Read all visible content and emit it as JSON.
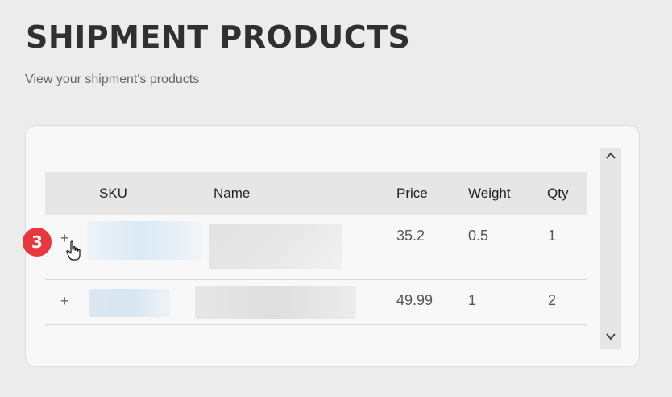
{
  "header": {
    "title": "SHIPMENT PRODUCTS",
    "subtitle": "View your shipment's products"
  },
  "table": {
    "columns": [
      "SKU",
      "Name",
      "Price",
      "Weight",
      "Qty"
    ],
    "rows": [
      {
        "expand": "+",
        "price": "35.2",
        "weight": "0.5",
        "qty": "1"
      },
      {
        "expand": "+",
        "price": "49.99",
        "weight": "1",
        "qty": "2"
      }
    ]
  },
  "scrollbar": {
    "up": "▲",
    "down": "▼"
  },
  "annotation": {
    "step": "3"
  },
  "icons": {
    "cursor": "hand-pointer-icon",
    "scroll_up": "chevron-up-icon",
    "scroll_down": "chevron-down-icon"
  },
  "colors": {
    "badge": "#e8373e",
    "background": "#ececec",
    "card": "#f8f8f8"
  }
}
